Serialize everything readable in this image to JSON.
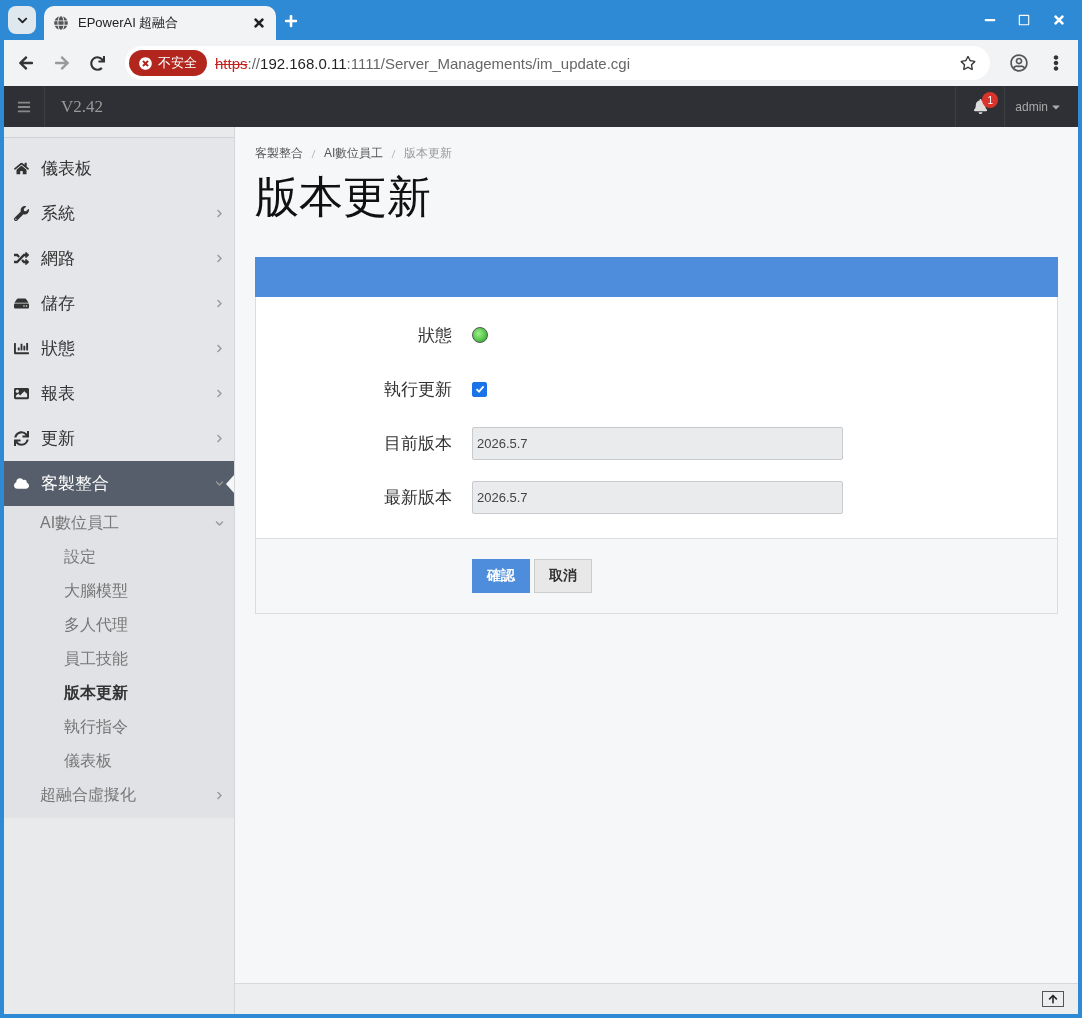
{
  "browser": {
    "tab_title": "EPowerAI 超融合",
    "security_label": "不安全",
    "url": [
      {
        "kind": "scheme",
        "text": "https"
      },
      {
        "kind": "dim",
        "text": "://"
      },
      {
        "kind": "host",
        "text": "192.168.0.11"
      },
      {
        "kind": "dim",
        "text": ":1111/Server_Managements/im_update.cgi"
      }
    ]
  },
  "header": {
    "version": "V2.42",
    "notification_count": "1",
    "user": "admin"
  },
  "sidebar": {
    "items": [
      {
        "label": "儀表板",
        "expanded": false,
        "has_children": false
      },
      {
        "label": "系統",
        "expanded": false,
        "has_children": true
      },
      {
        "label": "網路",
        "expanded": false,
        "has_children": true
      },
      {
        "label": "儲存",
        "expanded": false,
        "has_children": true
      },
      {
        "label": "狀態",
        "expanded": false,
        "has_children": true
      },
      {
        "label": "報表",
        "expanded": false,
        "has_children": true
      },
      {
        "label": "更新",
        "expanded": false,
        "has_children": true
      },
      {
        "label": "客製整合",
        "expanded": true,
        "has_children": true,
        "children": [
          {
            "label": "AI數位員工",
            "expanded": true,
            "has_children": true,
            "children": [
              {
                "label": "設定",
                "selected": false
              },
              {
                "label": "大腦模型",
                "selected": false
              },
              {
                "label": "多人代理",
                "selected": false
              },
              {
                "label": "員工技能",
                "selected": false
              },
              {
                "label": "版本更新",
                "selected": true
              },
              {
                "label": "執行指令",
                "selected": false
              },
              {
                "label": "儀表板",
                "selected": false
              }
            ]
          },
          {
            "label": "超融合虛擬化",
            "expanded": false,
            "has_children": true
          }
        ]
      }
    ]
  },
  "breadcrumb": [
    "客製整合",
    "AI數位員工",
    "版本更新"
  ],
  "title": "版本更新",
  "form": {
    "rows": [
      {
        "kind": "status",
        "label": "狀態",
        "on": true
      },
      {
        "kind": "checkbox",
        "label": "執行更新",
        "checked": true
      },
      {
        "kind": "field",
        "label": "目前版本",
        "value": "2026.5.7"
      },
      {
        "kind": "field",
        "label": "最新版本",
        "value": "2026.5.7"
      }
    ],
    "buttons": [
      {
        "kind": "primary",
        "label": "確認"
      },
      {
        "kind": "default",
        "label": "取消"
      }
    ]
  }
}
